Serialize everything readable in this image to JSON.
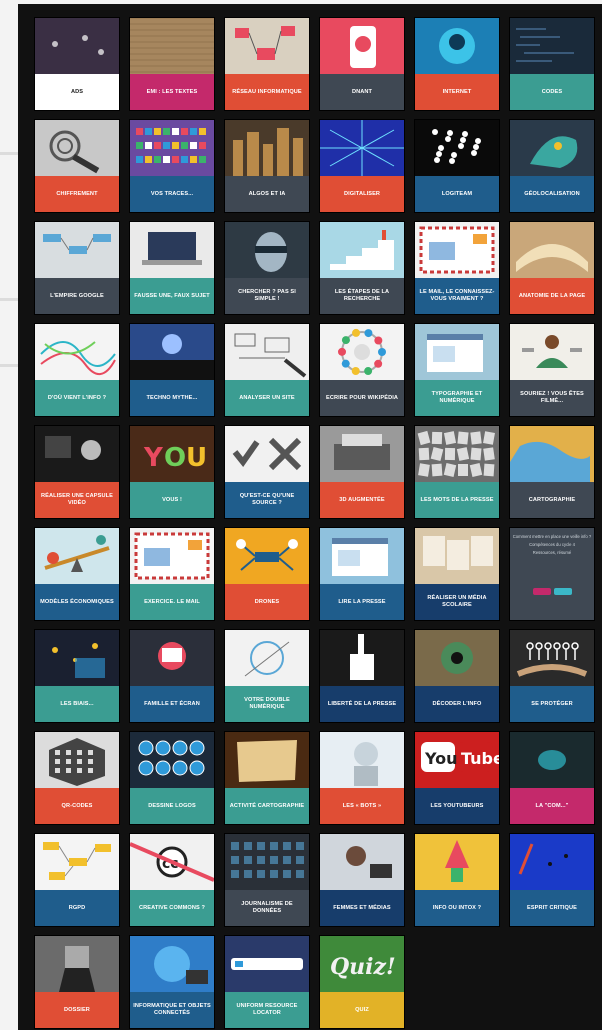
{
  "colors": {
    "red": "#e04e35",
    "teal": "#3b9d92",
    "blue": "#1f5d8c",
    "navy": "#173d6b",
    "slate": "#3f4853",
    "magenta": "#c4296b",
    "yellow": "#e2b227",
    "white": "#ffffff"
  },
  "tiles": [
    {
      "label": "Ads",
      "color": "#ffffff",
      "icon": "network-icon",
      "thumb": "#3a2f44"
    },
    {
      "label": "EMI : Les textes",
      "color": "#c4296b",
      "icon": "paper-texture-icon",
      "thumb": "#a6865e"
    },
    {
      "label": "Réseau informatique",
      "color": "#e04e35",
      "icon": "network-illustration-icon",
      "thumb": "#d9d0c0"
    },
    {
      "label": "Dnant",
      "color": "#3f4853",
      "icon": "smartphone-icon",
      "thumb": "#e84a5f"
    },
    {
      "label": "Internet",
      "color": "#e04e35",
      "icon": "globe-icon",
      "thumb": "#1c7fb5"
    },
    {
      "label": "Codes",
      "color": "#3b9d92",
      "icon": "code-icon",
      "thumb": "#1a2a3a"
    },
    {
      "label": "Chiffrement",
      "color": "#e04e35",
      "icon": "fingerprint-icon",
      "thumb": "#c8c8c8"
    },
    {
      "label": "Vos traces...",
      "color": "#1f5d8c",
      "icon": "social-apps-icon",
      "thumb": "#6a4aa0"
    },
    {
      "label": "Algos et IA",
      "color": "#3f4853",
      "icon": "city-icon",
      "thumb": "#4a3a2a"
    },
    {
      "label": "Digitaliser",
      "color": "#e04e35",
      "icon": "circuit-icon",
      "thumb": "#1f2fa8"
    },
    {
      "label": "Logiteam",
      "color": "#1f5d8c",
      "icon": "network-graph-icon",
      "thumb": "#0a0a0a"
    },
    {
      "label": "Géolocalisation",
      "color": "#1f5d8c",
      "icon": "map-pin-icon",
      "thumb": "#2a3a4a"
    },
    {
      "label": "L'empire Google",
      "color": "#3f4853",
      "icon": "diagram-icon",
      "thumb": "#d8dde0"
    },
    {
      "label": "Fausse Une, faux sujet",
      "color": "#3b9d92",
      "icon": "laptop-icon",
      "thumb": "#eaeaea"
    },
    {
      "label": "Chercher ? Pas si simple !",
      "color": "#3f4853",
      "icon": "face-icon",
      "thumb": "#2e3a44"
    },
    {
      "label": "Les étapes de la recherche",
      "color": "#3f4853",
      "icon": "stairs-icon",
      "thumb": "#a9d8e6"
    },
    {
      "label": "Le mail, le connaissez-vous vraiment ?",
      "color": "#1f5d8c",
      "icon": "envelope-icon",
      "thumb": "#f2f2f2"
    },
    {
      "label": "Anatomie de la page",
      "color": "#e04e35",
      "icon": "book-icon",
      "thumb": "#c9a77a"
    },
    {
      "label": "D'où vient l'info ?",
      "color": "#3b9d92",
      "icon": "map-lines-icon",
      "thumb": "#f4f4f4"
    },
    {
      "label": "Techno mythe...",
      "color": "#1f5d8c",
      "icon": "crowd-icon",
      "thumb": "#2a4a8a"
    },
    {
      "label": "Analyser un site",
      "color": "#3b9d92",
      "icon": "hand-drawing-icon",
      "thumb": "#efefef"
    },
    {
      "label": "Ecrire pour Wikipédia",
      "color": "#3f4853",
      "icon": "wikipedia-icon",
      "thumb": "#f3f3f3"
    },
    {
      "label": "Typographie et numérique",
      "color": "#3b9d92",
      "icon": "browser-icon",
      "thumb": "#9fc6d8"
    },
    {
      "label": "Souriez ! Vous êtes filmé...",
      "color": "#3f4853",
      "icon": "meditation-icon",
      "thumb": "#f1efe9"
    },
    {
      "label": "Réaliser une capsule vidéo",
      "color": "#e04e35",
      "icon": "film-set-icon",
      "thumb": "#1a1a1a"
    },
    {
      "label": "Vous !",
      "color": "#3b9d92",
      "icon": "you-letters-icon",
      "thumb": "#4a2a18"
    },
    {
      "label": "Qu'est-ce qu'une source ?",
      "color": "#1f5d8c",
      "icon": "check-cross-icon",
      "thumb": "#f1f1f1"
    },
    {
      "label": "3D augmentée",
      "color": "#e04e35",
      "icon": "typewriter-icon",
      "thumb": "#9a9a9a"
    },
    {
      "label": "Les mots de la presse",
      "color": "#3b9d92",
      "icon": "letters-icon",
      "thumb": "#6d6d6d"
    },
    {
      "label": "Cartographie",
      "color": "#3f4853",
      "icon": "map-icon",
      "thumb": "#e2b04a"
    },
    {
      "label": "Modèles économiques",
      "color": "#1f5d8c",
      "icon": "seesaw-icon",
      "thumb": "#cfe6ec"
    },
    {
      "label": "Exercice. Le mail",
      "color": "#3b9d92",
      "icon": "envelope-icon",
      "thumb": "#f2f2f2"
    },
    {
      "label": "Drones",
      "color": "#e04e35",
      "icon": "drone-icon",
      "thumb": "#f0a722"
    },
    {
      "label": "Lire la Presse",
      "color": "#1f5d8c",
      "icon": "browser-icon",
      "thumb": "#8fc1dd"
    },
    {
      "label": "Réaliser un média scolaire",
      "color": "#173d6b",
      "icon": "newspaper-icon",
      "thumb": "#d9c7a8"
    },
    {
      "label": "",
      "color": "#3f4853",
      "icon": "",
      "thumb": "#3f4853",
      "special": "text"
    },
    {
      "label": "Les biais...",
      "color": "#3b9d92",
      "icon": "lights-icon",
      "thumb": "#1a2030"
    },
    {
      "label": "Famille et écran",
      "color": "#1f5d8c",
      "icon": "family-icon",
      "thumb": "#2b2f3a"
    },
    {
      "label": "Votre double numérique",
      "color": "#3b9d92",
      "icon": "sketch-icon",
      "thumb": "#f2f2f2"
    },
    {
      "label": "Liberté de la Presse",
      "color": "#173d6b",
      "icon": "fist-pen-icon",
      "thumb": "#1a1a1a"
    },
    {
      "label": "Décoder l'info",
      "color": "#173d6b",
      "icon": "magnifier-eye-icon",
      "thumb": "#7a6a4a"
    },
    {
      "label": "Se protéger",
      "color": "#1f5d8c",
      "icon": "hands-people-icon",
      "thumb": "#2a2a2a"
    },
    {
      "label": "QR-Codes",
      "color": "#e04e35",
      "icon": "qr-cube-icon",
      "thumb": "#dcdcdc"
    },
    {
      "label": "Dessine Logos",
      "color": "#3b9d92",
      "icon": "hexagon-icon",
      "thumb": "#1c2a3a"
    },
    {
      "label": "Activité cartographie",
      "color": "#3b9d92",
      "icon": "parchment-icon",
      "thumb": "#4a2a12"
    },
    {
      "label": "Les « bots »",
      "color": "#e04e35",
      "icon": "robot-icon",
      "thumb": "#e7eef3"
    },
    {
      "label": "Les youtubeurs",
      "color": "#173d6b",
      "icon": "youtube-icon",
      "thumb": "#cc1f1f"
    },
    {
      "label": "La \"Com...\"",
      "color": "#c4296b",
      "icon": "spotlight-icon",
      "thumb": "#1a2a2e"
    },
    {
      "label": "RGPD",
      "color": "#1f5d8c",
      "icon": "mindmap-icon",
      "thumb": "#f4f4f4"
    },
    {
      "label": "Creative commons ?",
      "color": "#3b9d92",
      "icon": "cc-icon",
      "thumb": "#f1f1f1"
    },
    {
      "label": "Journalisme de données",
      "color": "#3f4853",
      "icon": "data-grid-icon",
      "thumb": "#2a3038"
    },
    {
      "label": "Femmes et médias",
      "color": "#173d6b",
      "icon": "woman-icon",
      "thumb": "#d0d6dc"
    },
    {
      "label": "Info ou Intox ?",
      "color": "#1f5d8c",
      "icon": "rocket-icon",
      "thumb": "#f0c23a"
    },
    {
      "label": "Esprit critique",
      "color": "#1f5d8c",
      "icon": "abstract-icon",
      "thumb": "#1a3ac8"
    },
    {
      "label": "Dossier",
      "color": "#e04e35",
      "icon": "man-suit-icon",
      "thumb": "#6b6b6b"
    },
    {
      "label": "Informatique et objets connectés",
      "color": "#1f5d8c",
      "icon": "earth-devices-icon",
      "thumb": "#2f7dc8"
    },
    {
      "label": "Uniform Resource Locator",
      "color": "#3b9d92",
      "icon": "url-bar-icon",
      "thumb": "#2a3a6a"
    },
    {
      "label": "Quiz",
      "color": "#e2b227",
      "icon": "quiz-chalkboard-icon",
      "thumb": "#3f8a3a"
    }
  ],
  "text_tile": {
    "line1": "Comment mettre en place une veille info ?",
    "line2": "Compétences du cycle 4",
    "line3": "Ressources, résumé"
  }
}
